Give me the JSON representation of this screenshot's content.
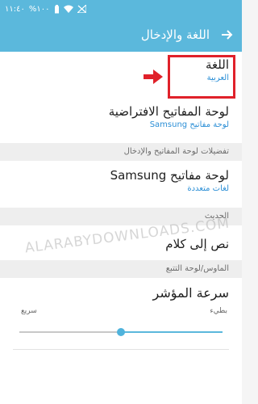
{
  "status_bar": {
    "time": "١١:٤٠",
    "battery": "%١٠٠",
    "battery_icon": "battery-icon",
    "wifi_icon": "wifi-icon",
    "signal_icon": "no-signal-icon"
  },
  "app_bar": {
    "title": "اللغة والإدخال",
    "back_icon": "back-arrow-icon"
  },
  "items": [
    {
      "title": "اللغة",
      "subtitle": "العربية"
    },
    {
      "title": "لوحة المفاتيح الافتراضية",
      "subtitle": "لوحة مفاتيح Samsung"
    },
    {
      "title": "لوحة مفاتيح Samsung",
      "subtitle": "لغات متعددة"
    },
    {
      "title": "نص إلى كلام"
    },
    {
      "title": "سرعة المؤشر"
    }
  ],
  "sections": [
    "تفضيلات لوحة المفاتيح والإدخال",
    "الحديث",
    "الماوس/لوحة التتبع"
  ],
  "pointer_speed": {
    "slow_label": "بطيء",
    "fast_label": "سريع",
    "value": 0.5
  },
  "watermark": "ALARABYDOWNLOADS.COM",
  "colors": {
    "accent": "#5bb8dc",
    "link": "#2c8fd6",
    "highlight": "#e0212a"
  }
}
